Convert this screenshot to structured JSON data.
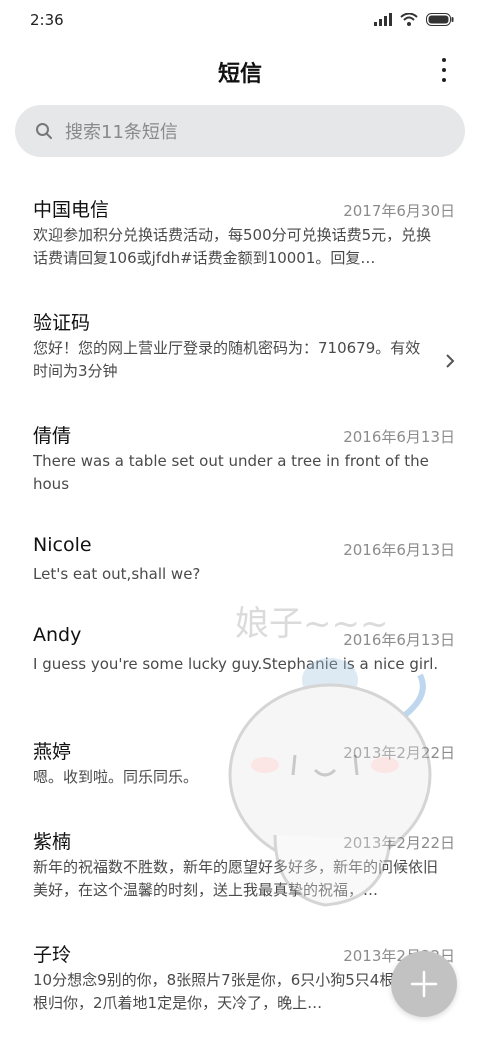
{
  "status_bar": {
    "time": "2:36"
  },
  "header": {
    "title": "短信"
  },
  "search": {
    "placeholder": "搜索11条短信"
  },
  "threads": [
    {
      "name": "中国电信",
      "date": "2017年6月30日",
      "preview": "欢迎参加积分兑换话费活动，每500分可兑换话费5元，兑换话费请回复106或jfdh#话费金额到10001。回复…"
    },
    {
      "name": "验证码",
      "date": "",
      "preview": "您好！您的网上营业厅登录的随机密码为：710679。有效时间为3分钟",
      "has_chevron": true
    },
    {
      "name": "倩倩",
      "date": "2016年6月13日",
      "preview": "There was a table set out under a tree in front of the hous"
    },
    {
      "name": "Nicole",
      "date": "2016年6月13日",
      "preview": "Let's eat out,shall we?"
    },
    {
      "name": "Andy",
      "date": "2016年6月13日",
      "preview": "I guess you're some lucky guy.Stephanie is a nice girl."
    },
    {
      "name": "燕婷",
      "date": "2013年2月22日",
      "preview": "嗯。收到啦。同乐同乐。"
    },
    {
      "name": "紫楠",
      "date": "2013年2月22日",
      "preview": "新年的祝福数不胜数，新年的愿望好多好多，新年的问候依旧美好，在这个温馨的时刻，送上我最真挚的祝福，…"
    },
    {
      "name": "子玲",
      "date": "2013年2月22日",
      "preview": "10分想念9别的你，8张照片7张是你，6只小狗5只4根骨头3根归你，2爪着地1定是你，天冷了，晚上…"
    }
  ],
  "watermark": {
    "text": "娘子~~~"
  },
  "icons": {
    "signal": "signal-icon",
    "wifi": "wifi-icon",
    "battery": "battery-icon",
    "more": "more-vertical-icon",
    "search": "search-icon",
    "chevron": "chevron-right-icon",
    "compose": "plus-icon"
  }
}
